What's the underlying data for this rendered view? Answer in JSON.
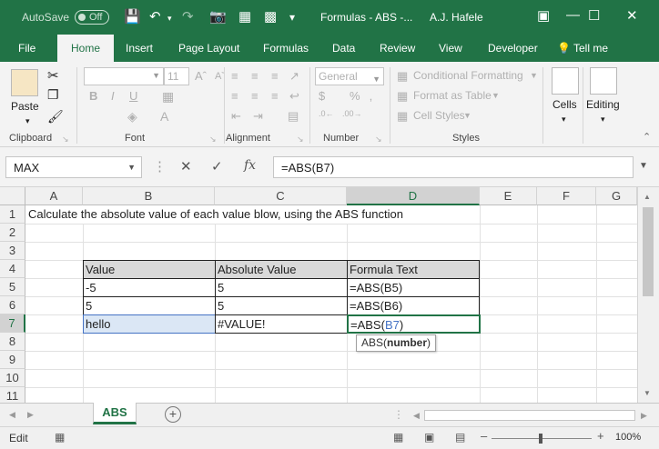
{
  "title_bar": {
    "autosave_label": "AutoSave",
    "autosave_state": "Off",
    "document_title": "Formulas - ABS  -...",
    "user_name": "A.J. Hafele"
  },
  "tabs": [
    "File",
    "Home",
    "Insert",
    "Page Layout",
    "Formulas",
    "Data",
    "Review",
    "View",
    "Developer",
    "Tell me"
  ],
  "active_tab": "Home",
  "ribbon": {
    "clipboard": {
      "paste_label": "Paste",
      "group_label": "Clipboard"
    },
    "font": {
      "size_value": "11",
      "group_label": "Font"
    },
    "alignment": {
      "group_label": "Alignment"
    },
    "number": {
      "format_value": "General",
      "group_label": "Number"
    },
    "styles": {
      "conditional_formatting": "Conditional Formatting",
      "format_as_table": "Format as Table",
      "cell_styles": "Cell Styles",
      "group_label": "Styles"
    },
    "cells": {
      "label": "Cells"
    },
    "editing": {
      "label": "Editing"
    }
  },
  "formula_bar": {
    "name_box": "MAX",
    "formula": "=ABS(B7)"
  },
  "columns": [
    "A",
    "B",
    "C",
    "D",
    "E",
    "F",
    "G"
  ],
  "rows": [
    "1",
    "2",
    "3",
    "4",
    "5",
    "6",
    "7",
    "8",
    "9",
    "10",
    "11"
  ],
  "cells": {
    "A1": "Calculate the absolute value of each value blow, using the ABS function",
    "B4": "Value",
    "C4": "Absolute Value",
    "D4": "Formula Text",
    "B5": "-5",
    "C5": "5",
    "D5": "=ABS(B5)",
    "B6": "5",
    "C6": "5",
    "D6": "=ABS(B6)",
    "B7": "hello",
    "C7": "#VALUE!",
    "D7_prefix": "=ABS(",
    "D7_ref": "B7",
    "D7_suffix": ")"
  },
  "tooltip": {
    "fn": "ABS(",
    "arg": "number",
    "close": ")"
  },
  "sheet_tab": "ABS",
  "status": {
    "mode": "Edit",
    "zoom": "100%"
  },
  "colors": {
    "accent": "#217346",
    "reference": "#4472c4"
  }
}
